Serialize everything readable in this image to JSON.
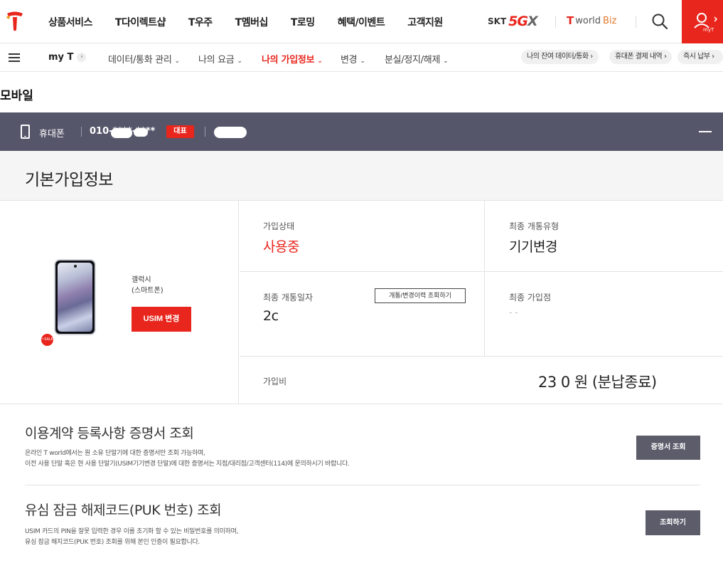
{
  "top_nav": {
    "menu": [
      "상품서비스",
      "T다이렉트샵",
      "T우주",
      "T멤버십",
      "T로밍",
      "혜택/이벤트",
      "고객지원"
    ],
    "brand_skt": "SKT",
    "brand_5g": "5G",
    "brand_x": "X",
    "worldbiz_t": "T",
    "worldbiz_world": "world",
    "worldbiz_biz": "Biz",
    "myt_label": "myT",
    "accent_color": "#e8261d"
  },
  "sub_nav": {
    "myt": "my T",
    "items": [
      {
        "label": "데이터/통화 관리",
        "active": false
      },
      {
        "label": "나의 요금",
        "active": false
      },
      {
        "label": "나의 가입정보",
        "active": true
      },
      {
        "label": "변경",
        "active": false
      },
      {
        "label": "분실/정지/해제",
        "active": false
      }
    ],
    "quick_links": [
      "나의 잔여 데이터/통화",
      "휴대폰 결제 내역",
      "즉시 납부"
    ]
  },
  "page_title": "모바일",
  "line_bar": {
    "line_type": "휴대폰",
    "number": "010-****-****",
    "badge": "대표",
    "bar_color": "#55566a"
  },
  "basic_info": {
    "title": "기본가입정보",
    "device": {
      "model_line1": "갤럭시",
      "model_line2": "(스마트폰)",
      "usim_button": "USIM 변경",
      "sale_badge": "~SALE"
    },
    "status_label": "가입상태",
    "status_value": "사용중",
    "last_activation_type_label": "최종 개통유형",
    "last_activation_type_value": "기기변경",
    "last_activation_date_label": "최종 개통일자",
    "last_activation_date_value": "2c",
    "history_button": "개통/변경이력 조회하기",
    "last_store_label": "최종 가입점",
    "last_store_value": "- -",
    "fee_label": "가입비",
    "fee_value": "23   0 원 (분납종료)"
  },
  "certificate": {
    "title": "이용계약 등록사항 증명서 조회",
    "desc1": "온라인 T world에서는 원 소유 단말기에 대한 증명서만 조회 가능하며,",
    "desc2": "이전 사용 단말 혹은 현 사용 단말기(USIM기기변경 단말)에 대한 증명서는 지점/대리점/고객센터(114)에 문의하시기 바랍니다.",
    "button": "증명서 조회"
  },
  "puk": {
    "title": "유심 잠금 해제코드(PUK 번호) 조회",
    "desc1": "USIM 카드의 PIN을 잘못 입력한 경우 이를 초기화 할 수 있는 비밀번호를 의미하며,",
    "desc2": "유심 잠금 해지코드(PUK 번호) 조회를 위해 본인 인증이 필요합니다.",
    "button": "조회하기"
  }
}
